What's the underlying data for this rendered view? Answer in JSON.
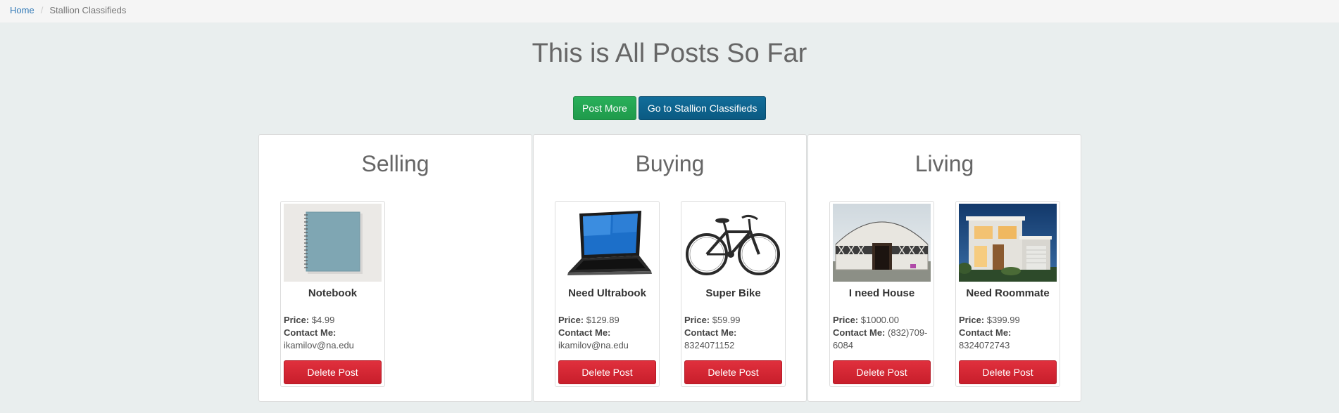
{
  "breadcrumb": {
    "home": "Home",
    "current": "Stallion Classifieds",
    "separator": "/"
  },
  "page_title": "This is All Posts So Far",
  "buttons": {
    "post_more": "Post More",
    "go_to": "Go to Stallion Classifieds"
  },
  "labels": {
    "price": "Price:",
    "contact": "Contact Me:",
    "delete": "Delete Post"
  },
  "colors": {
    "accent_green": "#22a552",
    "accent_blue": "#0e6490",
    "danger_red": "#d42734",
    "link_blue": "#337ab7"
  },
  "sections": [
    {
      "title": "Selling",
      "posts": [
        {
          "title": "Notebook",
          "price": "$4.99",
          "contact_line1": "ikamilov@na.edu",
          "contact_line2": "",
          "image": "notebook-image"
        }
      ]
    },
    {
      "title": "Buying",
      "posts": [
        {
          "title": "Need Ultrabook",
          "price": "$129.89",
          "contact_line1": "ikamilov@na.edu",
          "contact_line2": "",
          "image": "laptop-image"
        },
        {
          "title": "Super Bike",
          "price": "$59.99",
          "contact_line1": "8324071152",
          "contact_line2": "",
          "image": "bicycle-image"
        }
      ]
    },
    {
      "title": "Living",
      "posts": [
        {
          "title": "I need House",
          "price": "$1000.00",
          "contact_inline": "(832)709-",
          "contact_line2": "6084",
          "image": "yurt-image"
        },
        {
          "title": "Need Roommate",
          "price": "$399.99",
          "contact_line1": "8324072743",
          "contact_line2": "",
          "image": "modern-house-image"
        }
      ]
    }
  ]
}
